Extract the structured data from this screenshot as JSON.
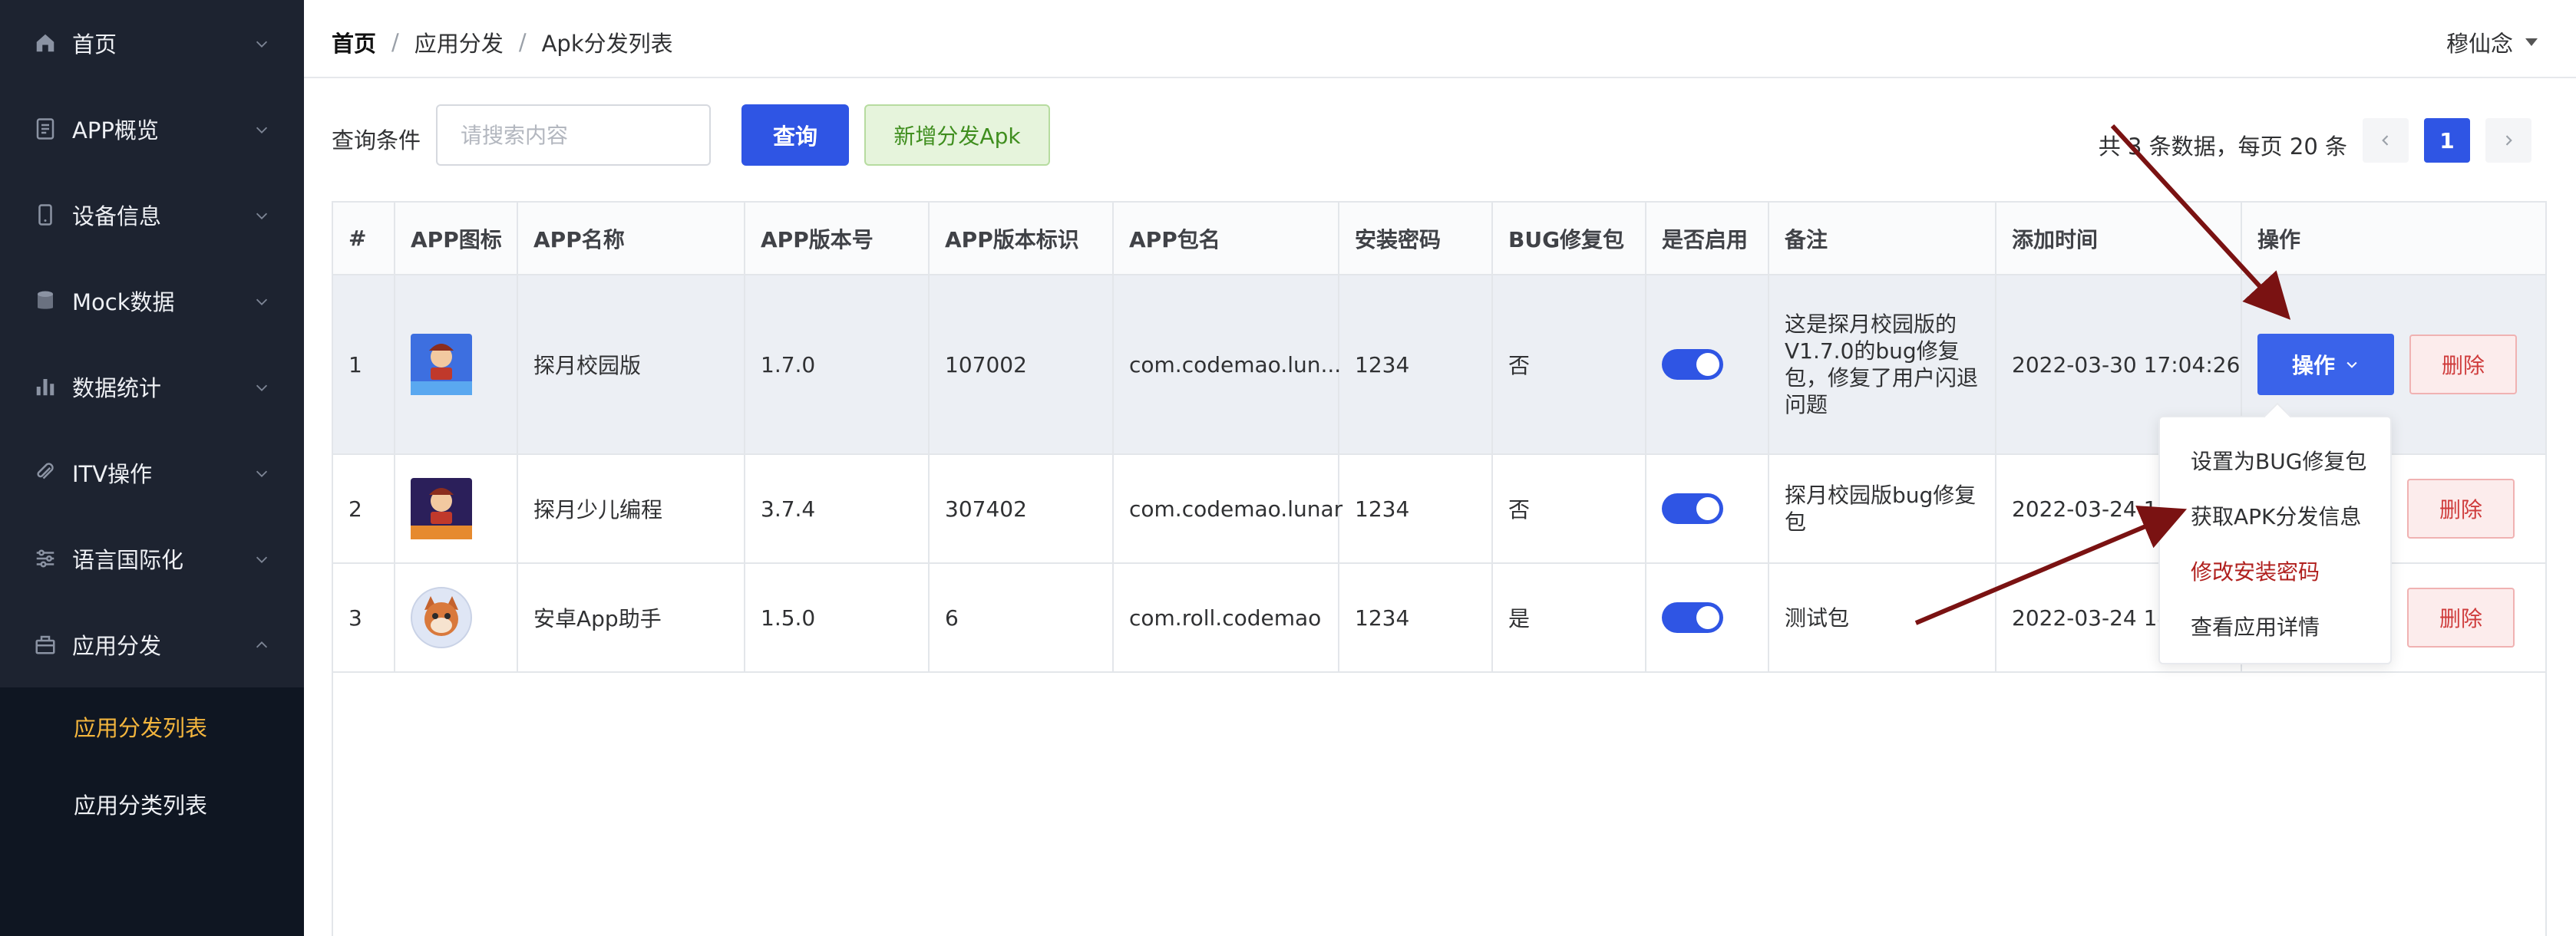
{
  "sidebar": {
    "items": [
      {
        "label": "首页",
        "icon": "home-icon"
      },
      {
        "label": "APP概览",
        "icon": "document-icon"
      },
      {
        "label": "设备信息",
        "icon": "phone-icon"
      },
      {
        "label": "Mock数据",
        "icon": "database-icon"
      },
      {
        "label": "数据统计",
        "icon": "bar-chart-icon"
      },
      {
        "label": "ITV操作",
        "icon": "paperclip-icon"
      },
      {
        "label": "语言国际化",
        "icon": "sliders-icon"
      },
      {
        "label": "应用分发",
        "icon": "package-icon"
      }
    ],
    "submenu": [
      {
        "label": "应用分发列表",
        "active": true
      },
      {
        "label": "应用分类列表",
        "active": false
      }
    ]
  },
  "header": {
    "breadcrumb": [
      "首页",
      "应用分发",
      "Apk分发列表"
    ],
    "separator": "/",
    "user": "穆仙念"
  },
  "toolbar": {
    "query_label": "查询条件",
    "search_placeholder": "请搜索内容",
    "search_value": "",
    "query_button": "查询",
    "add_button": "新增分发Apk"
  },
  "pagination": {
    "summary": "共 3 条数据，每页 20 条",
    "current_page": "1"
  },
  "table": {
    "columns": [
      "#",
      "APP图标",
      "APP名称",
      "APP版本号",
      "APP版本标识",
      "APP包名",
      "安装密码",
      "BUG修复包",
      "是否启用",
      "备注",
      "添加时间",
      "操作"
    ],
    "rows": [
      {
        "index": "1",
        "name": "探月校园版",
        "version": "1.7.0",
        "version_code": "107002",
        "package": "com.codemao.lun...",
        "password": "1234",
        "bugfix": "否",
        "enabled": true,
        "note": "这是探月校园版的V1.7.0的bug修复包，修复了用户闪退问题",
        "added": "2022-03-30 17:04:26"
      },
      {
        "index": "2",
        "name": "探月少儿编程",
        "version": "3.7.4",
        "version_code": "307402",
        "package": "com.codemao.lunar",
        "password": "1234",
        "bugfix": "否",
        "enabled": true,
        "note": "探月校园版bug修复包",
        "added": "2022-03-24 14:"
      },
      {
        "index": "3",
        "name": "安卓App助手",
        "version": "1.5.0",
        "version_code": "6",
        "package": "com.roll.codemao",
        "password": "1234",
        "bugfix": "是",
        "enabled": true,
        "note": "测试包",
        "added": "2022-03-24 14:"
      }
    ],
    "op_button": "操作",
    "delete_button": "删除"
  },
  "dropdown": {
    "items": [
      {
        "label": "设置为BUG修复包",
        "danger": false
      },
      {
        "label": "获取APK分发信息",
        "danger": false
      },
      {
        "label": "修改安装密码",
        "danger": true
      },
      {
        "label": "查看应用详情",
        "danger": false
      }
    ]
  },
  "colors": {
    "sidebar_bg": "#0f1622",
    "sidebar_top_bg": "#1d2330",
    "active_submenu": "#f3b53d",
    "primary": "#2f55e4",
    "success_bg": "#e6f4dc",
    "danger": "#cf3c3c",
    "annotation_arrow": "#7a1212"
  }
}
